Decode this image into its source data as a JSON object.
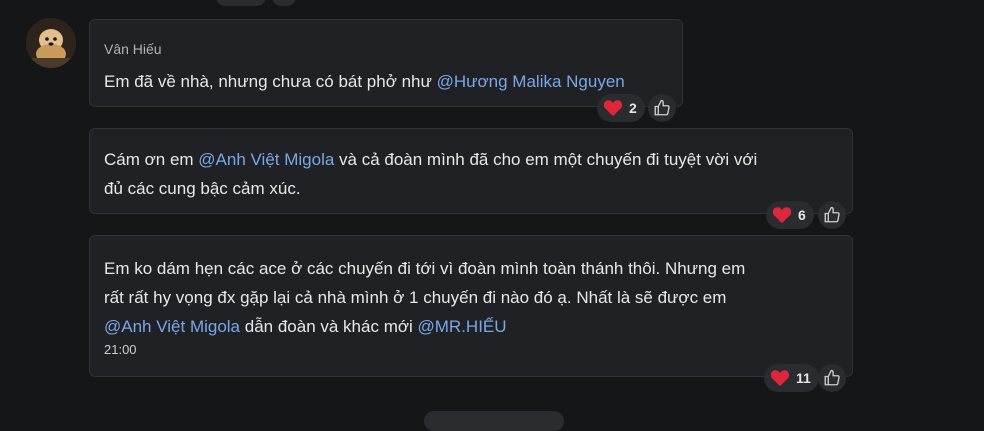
{
  "messages": [
    {
      "sender": "Vân Hiếu",
      "lines": [
        [
          {
            "t": "Em đã về nhà, nhưng chưa có bát phở như "
          },
          {
            "t": "@Hương Malika Nguyen",
            "m": true
          }
        ]
      ],
      "reactions": {
        "heart_count": "2"
      }
    },
    {
      "lines": [
        [
          {
            "t": "Cám ơn em "
          },
          {
            "t": "@Anh Việt Migola",
            "m": true
          },
          {
            "t": "  và cả đoàn mình đã cho em một chuyến đi tuyệt vời với"
          }
        ],
        [
          {
            "t": "đủ các cung bậc cảm xúc."
          }
        ]
      ],
      "reactions": {
        "heart_count": "6"
      }
    },
    {
      "lines": [
        [
          {
            "t": "Em ko dám hẹn các ace ở các chuyến đi tới vì đoàn mình toàn thánh thôi. Nhưng em"
          }
        ],
        [
          {
            "t": "rất rất hy vọng đx gặp lại cả nhà mình ở 1 chuyến đi nào đó ạ. Nhất là sẽ được em"
          }
        ],
        [
          {
            "t": "@Anh Việt Migola",
            "m": true
          },
          {
            "t": "  dẫn đoàn và khác mới "
          },
          {
            "t": "@MR.HIẾU",
            "m": true
          }
        ]
      ],
      "time": "21:00",
      "reactions": {
        "heart_count": "11"
      }
    }
  ],
  "icons": {
    "reaction": "heart-icon",
    "like": "thumbs-up-icon"
  },
  "colors": {
    "mention": "#7aa7e8",
    "heart": "#e0263a",
    "bubble": "#202124",
    "background": "#151618"
  }
}
